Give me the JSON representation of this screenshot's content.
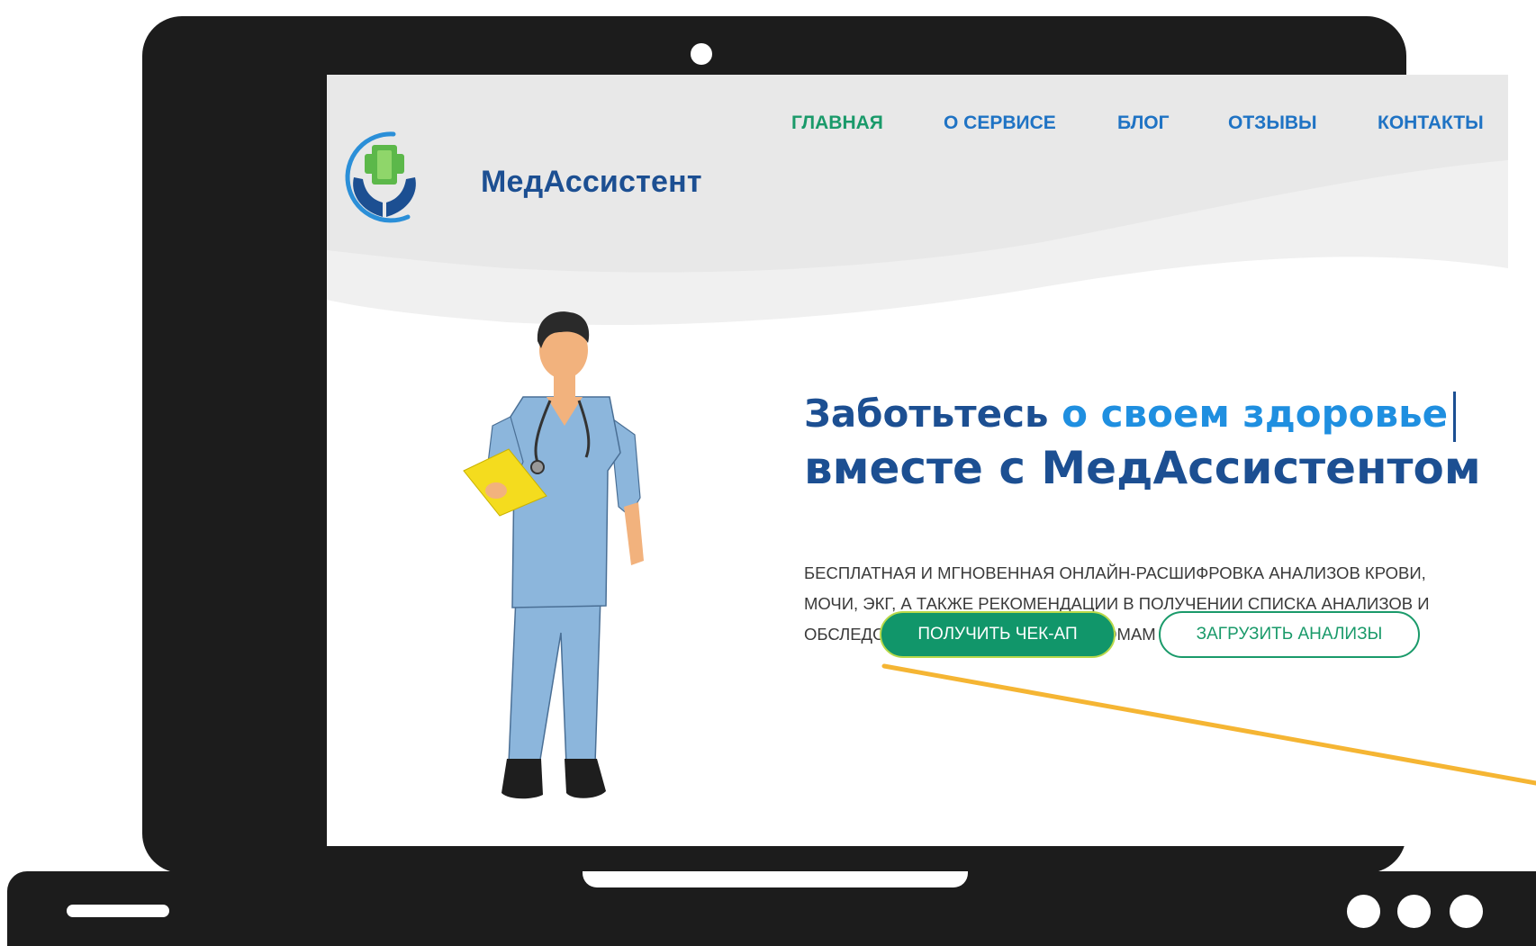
{
  "brand": {
    "name": "МедАссистент"
  },
  "nav": {
    "items": [
      {
        "label": "ГЛАВНАЯ"
      },
      {
        "label": "О СЕРВИСЕ"
      },
      {
        "label": "БЛОГ"
      },
      {
        "label": "ОТЗЫВЫ"
      },
      {
        "label": "КОНТАКТЫ"
      }
    ],
    "active": "ГЛАВНАЯ"
  },
  "hero": {
    "headline_part1": "Заботьтесь",
    "headline_part2": "о своем здоровье",
    "headline_line2": "вместе с МедАссистентом",
    "description": [
      "БЕСПЛАТНАЯ И МГНОВЕННАЯ ОНЛАЙН-РАСШИФРОВКА АНАЛИЗОВ КРОВИ,",
      "МОЧИ, ЭКГ, А ТАКЖЕ РЕКОМЕНДАЦИИ В ПОЛУЧЕНИИ СПИСКА АНАЛИЗОВ И",
      "ОБСЛЕДОВАНИЙ ПО ВАШИМ СИМПТОМАМ И ЖАЛОБАМ"
    ],
    "primary_button": "ПОЛУЧИТЬ ЧЕК-АП",
    "secondary_button": "ЗАГРУЗИТЬ АНАЛИЗЫ"
  },
  "colors": {
    "laptop": "#1c1c1c",
    "brand_blue": "#1c4f92",
    "link_blue": "#1f73c4",
    "accent_green": "#1a9a6a",
    "pointer_line": "#f5b533"
  },
  "icons": {
    "logo": "hands-cross-icon",
    "illustration": "doctor-illustration"
  }
}
